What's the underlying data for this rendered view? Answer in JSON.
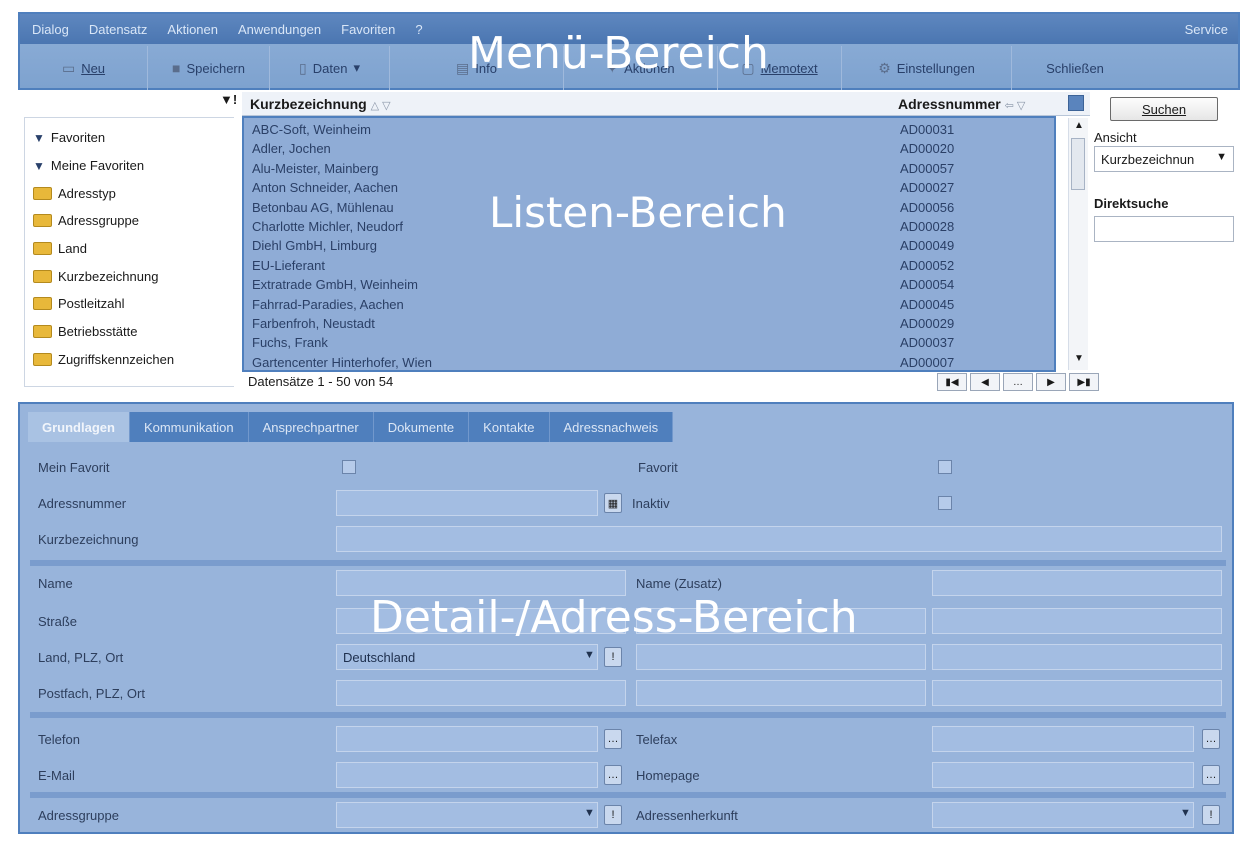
{
  "menubar": {
    "items": [
      "Dialog",
      "Datensatz",
      "Aktionen",
      "Anwendungen",
      "Favoriten",
      "?"
    ],
    "right": "Service"
  },
  "toolbar": {
    "neu": "Neu",
    "speichern": "Speichern",
    "daten": "Daten",
    "info": "Info",
    "aktionen": "Aktionen",
    "memotext": "Memotext",
    "einstellungen": "Einstellungen",
    "schliessen": "Schließen"
  },
  "overlays": {
    "menu": "Menü-Bereich",
    "list": "Listen-Bereich",
    "detail": "Detail-/Adress-Bereich"
  },
  "tree": {
    "items": [
      {
        "label": "Favoriten",
        "icon": "funnel-icon"
      },
      {
        "label": "Meine Favoriten",
        "icon": "funnel-icon"
      },
      {
        "label": "Adresstyp",
        "icon": "folder-icon"
      },
      {
        "label": "Adressgruppe",
        "icon": "folder-icon"
      },
      {
        "label": "Land",
        "icon": "folder-icon"
      },
      {
        "label": "Kurzbezeichnung",
        "icon": "folder-icon"
      },
      {
        "label": "Postleitzahl",
        "icon": "folder-icon"
      },
      {
        "label": "Betriebsstätte",
        "icon": "folder-icon"
      },
      {
        "label": "Zugriffskennzeichen",
        "icon": "folder-icon"
      }
    ]
  },
  "list": {
    "col1": "Kurzbezeichnung",
    "col2": "Adressnummer",
    "rows": [
      [
        "ABC-Soft, Weinheim",
        "AD00031"
      ],
      [
        "Adler, Jochen",
        "AD00020"
      ],
      [
        "Alu-Meister, Mainberg",
        "AD00057"
      ],
      [
        "Anton Schneider, Aachen",
        "AD00027"
      ],
      [
        "Betonbau AG, Mühlenau",
        "AD00056"
      ],
      [
        "Charlotte Michler, Neudorf",
        "AD00028"
      ],
      [
        "Diehl GmbH, Limburg",
        "AD00049"
      ],
      [
        "EU-Lieferant",
        "AD00052"
      ],
      [
        "Extratrade GmbH, Weinheim",
        "AD00054"
      ],
      [
        "Fahrrad-Paradies, Aachen",
        "AD00045"
      ],
      [
        "Farbenfroh, Neustadt",
        "AD00029"
      ],
      [
        "Fuchs, Frank",
        "AD00037"
      ],
      [
        "Gartencenter Hinterhofer, Wien",
        "AD00007"
      ]
    ],
    "count": "Datensätze 1 - 50 von 54"
  },
  "search": {
    "button": "Suchen",
    "ansicht_label": "Ansicht",
    "ansicht_value": "Kurzbezeichnun",
    "direkt_label": "Direktsuche"
  },
  "detail": {
    "tabs": [
      "Grundlagen",
      "Kommunikation",
      "Ansprechpartner",
      "Dokumente",
      "Kontakte",
      "Adressnachweis"
    ],
    "labels": {
      "mein_favorit": "Mein Favorit",
      "favorit": "Favorit",
      "adressnummer": "Adressnummer",
      "inaktiv": "Inaktiv",
      "kurzbezeichnung": "Kurzbezeichnung",
      "name": "Name",
      "name_zusatz": "Name (Zusatz)",
      "strasse": "Straße",
      "land": "Land, PLZ, Ort",
      "postfach": "Postfach, PLZ, Ort",
      "telefon": "Telefon",
      "telefax": "Telefax",
      "email": "E-Mail",
      "homepage": "Homepage",
      "adressgruppe": "Adressgruppe",
      "adressenherkunft": "Adressenherkunft"
    },
    "land_value": "Deutschland"
  }
}
